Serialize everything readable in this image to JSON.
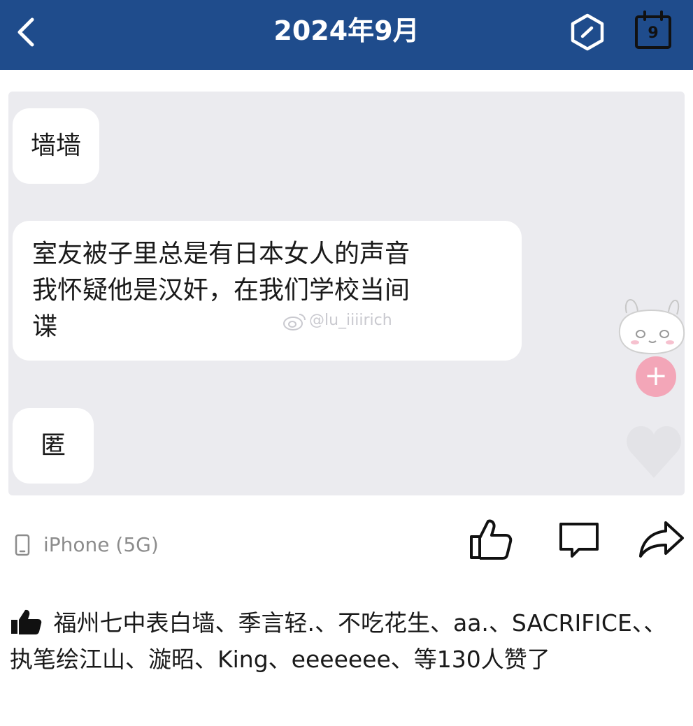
{
  "header": {
    "title": "2024年9月",
    "calendar_day": "9",
    "bg_color": "#1f4c8c"
  },
  "messages": [
    {
      "lines": [
        "墙墙"
      ]
    },
    {
      "lines": [
        "室友被子里总是有日本女人的声音",
        "我怀疑他是汉奸，在我们学校当间",
        "谍"
      ]
    },
    {
      "lines": [
        "匿"
      ]
    }
  ],
  "watermark": {
    "text": "@lu_iiiirich",
    "icon": "weibo-icon"
  },
  "footer": {
    "device_icon": "phone-icon",
    "device_label": "iPhone (5G)",
    "actions": [
      "like-icon",
      "comment-icon",
      "share-icon"
    ]
  },
  "likes": {
    "icon": "thumbs-up-icon",
    "text": "福州七中表白墙、季言轻.、不吃花生、aa.、SACRIFICE、、执笔绘江山、漩昭、King、eeeeeee、等130人赞了"
  },
  "colors": {
    "chat_bg": "#ebebef",
    "plus_button": "#f3a6b8"
  }
}
